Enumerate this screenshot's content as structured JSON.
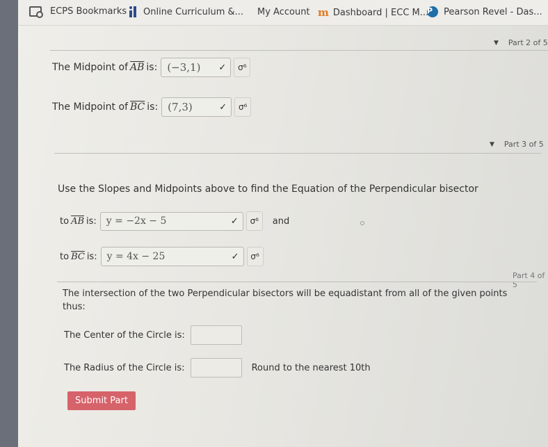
{
  "bookmarks": [
    {
      "icon": "folder-icon",
      "label": "ECPS Bookmarks"
    },
    {
      "icon": "online-curriculum-icon",
      "label": "Online Curriculum &..."
    },
    {
      "icon": "microsoft-icon",
      "label": "My Account"
    },
    {
      "icon": "moodle-icon",
      "label": "Dashboard | ECC M..."
    },
    {
      "icon": "pearson-icon",
      "label": "Pearson Revel - Das..."
    }
  ],
  "icons": {
    "moodle_glyph": "m",
    "pearson_glyph": "P",
    "triangle": "▼",
    "check": "✓",
    "symbol_button": "σ⁶"
  },
  "part2": {
    "header": "Part 2 of 5",
    "rows": [
      {
        "prefix": "The Midpoint of",
        "segment": "AB",
        "suffix": "is:",
        "value": "(−3,1)"
      },
      {
        "prefix": "The Midpoint of",
        "segment": "BC",
        "suffix": "is:",
        "value": "(7,3)"
      }
    ]
  },
  "part3": {
    "header": "Part 3 of 5",
    "instruction": "Use the Slopes and Midpoints above to find the Equation of the Perpendicular bisector",
    "rows": [
      {
        "prefix": "to",
        "segment": "AB",
        "suffix": "is:",
        "value": "y = −2x − 5",
        "trailing": "and"
      },
      {
        "prefix": "to",
        "segment": "BC",
        "suffix": "is:",
        "value": "y = 4x − 25"
      }
    ]
  },
  "part4": {
    "header": "Part 4 of 5",
    "statement": "The intersection of the two Perpendicular bisectors will be equadistant from all of the given points thus:",
    "center_label": "The Center of the Circle is:",
    "center_value": "",
    "radius_label": "The Radius of the Circle is:",
    "radius_value": "",
    "radius_hint": "Round to the nearest 10th",
    "submit_label": "Submit Part"
  },
  "colors": {
    "submit": "#d6626a",
    "pearson": "#1f6ea8",
    "moodle": "#e07a20"
  }
}
